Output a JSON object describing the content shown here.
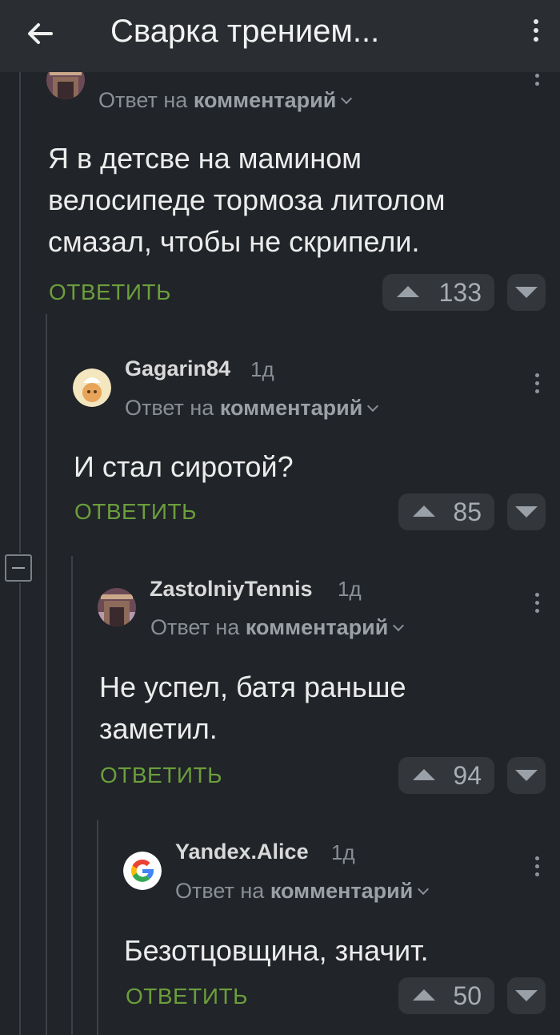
{
  "header": {
    "title": "Сварка трением...",
    "back_icon": "arrow-left-icon",
    "menu_icon": "kebab-menu-icon"
  },
  "comments": [
    {
      "user": "",
      "age": "",
      "reply_prefix": "Ответ на",
      "reply_target": "комментарий",
      "lines": [
        "Я в детсве на мамином",
        "велосипеде тормоза литолом",
        "смазал, чтобы не скрипели."
      ],
      "answer": "ОТВЕТИТЬ",
      "votes": "133"
    },
    {
      "user": "Gagarin84",
      "age": "1д",
      "reply_prefix": "Ответ на",
      "reply_target": "комментарий",
      "lines": [
        "И стал сиротой?"
      ],
      "answer": "ОТВЕТИТЬ",
      "votes": "85"
    },
    {
      "user": "ZastolniyTennis",
      "age": "1д",
      "reply_prefix": "Ответ на",
      "reply_target": "комментарий",
      "lines": [
        "Не успел, батя раньше",
        "заметил."
      ],
      "answer": "ОТВЕТИТЬ",
      "votes": "94"
    },
    {
      "user": "Yandex.Alice",
      "age": "1д",
      "reply_prefix": "Ответ на",
      "reply_target": "комментарий",
      "lines": [
        "Безотцовщина, значит."
      ],
      "answer": "ОТВЕТИТЬ",
      "votes": "50"
    }
  ],
  "colors": {
    "background": "#212428",
    "appbar": "#2a2d31",
    "answer_green": "#6b9e3d",
    "vote_button": "#33373c"
  }
}
